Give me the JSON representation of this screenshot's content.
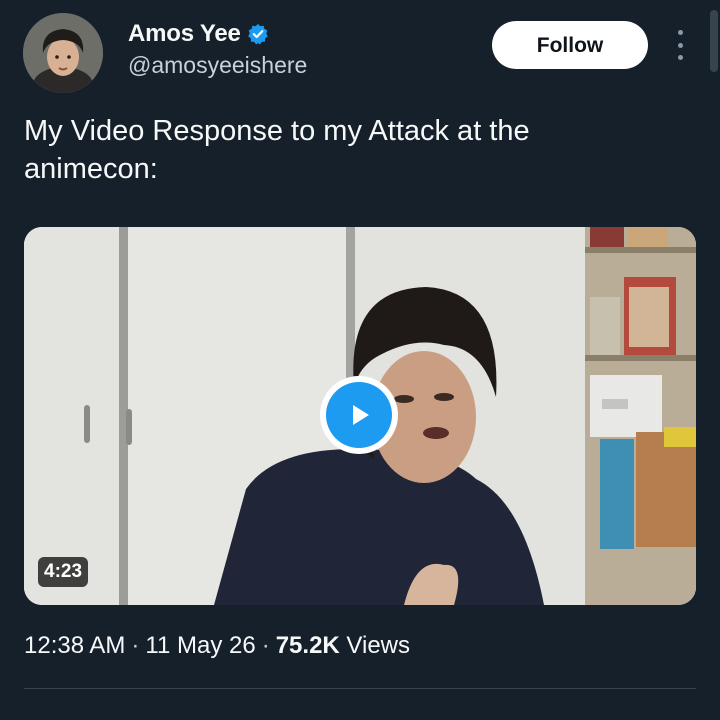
{
  "author": {
    "name": "Amos Yee",
    "handle": "@amosyeeishere",
    "verified_icon": "verified-badge-icon",
    "avatar_icon": "profile-photo"
  },
  "header": {
    "follow_label": "Follow",
    "more_icon": "more-vertical-icon"
  },
  "tweet": {
    "text": "My Video Response to my Attack at the animecon:"
  },
  "media": {
    "type": "video",
    "duration": "4:23",
    "play_icon": "play-icon"
  },
  "meta": {
    "time": "12:38 AM",
    "date": "11 May 26",
    "views_count": "75.2K",
    "views_label": "Views",
    "separator": "·"
  },
  "colors": {
    "background": "#15202b",
    "accent": "#1d9bf0",
    "text_primary": "#f7f9f9",
    "text_secondary": "#8b98a5",
    "divider": "#38444d"
  }
}
